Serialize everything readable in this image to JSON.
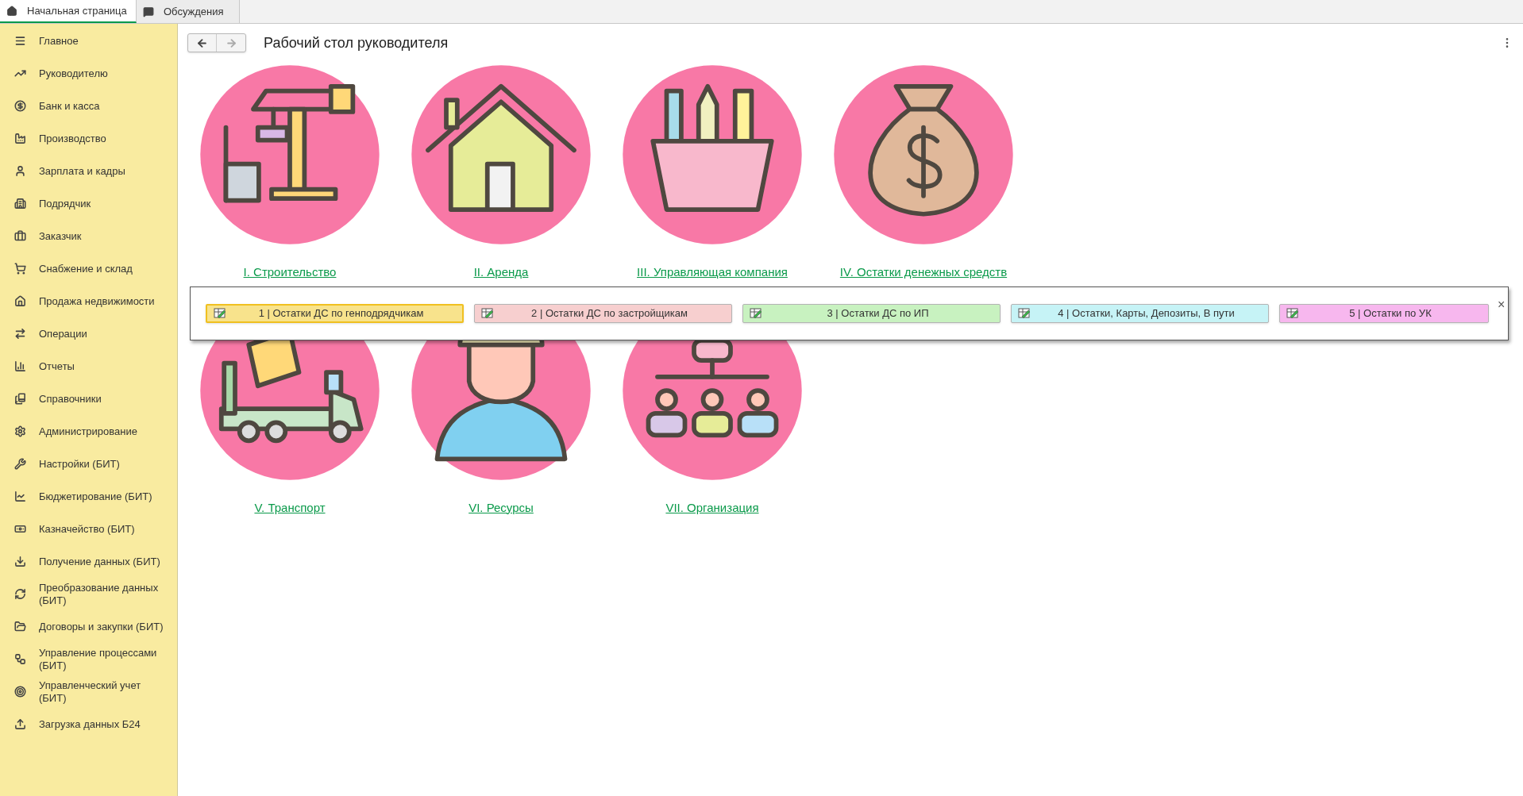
{
  "tabs": [
    {
      "label": "Начальная страница",
      "selected": true
    },
    {
      "label": "Обсуждения",
      "selected": false
    }
  ],
  "sidebar": {
    "items": [
      {
        "label": "Главное"
      },
      {
        "label": "Руководителю"
      },
      {
        "label": "Банк и касса"
      },
      {
        "label": "Производство"
      },
      {
        "label": "Зарплата и кадры"
      },
      {
        "label": "Подрядчик"
      },
      {
        "label": "Заказчик"
      },
      {
        "label": "Снабжение и склад"
      },
      {
        "label": "Продажа недвижимости"
      },
      {
        "label": "Операции"
      },
      {
        "label": "Отчеты"
      },
      {
        "label": "Справочники"
      },
      {
        "label": "Администрирование"
      },
      {
        "label": "Настройки (БИТ)"
      },
      {
        "label": "Бюджетирование (БИТ)"
      },
      {
        "label": "Казначейство (БИТ)"
      },
      {
        "label": "Получение данных (БИТ)"
      },
      {
        "label": "Преобразование данных (БИТ)"
      },
      {
        "label": "Договоры и закупки (БИТ)"
      },
      {
        "label": "Управление процессами (БИТ)"
      },
      {
        "label": "Управленческий учет (БИТ)"
      },
      {
        "label": "Загрузка данных Б24"
      }
    ]
  },
  "page": {
    "title": "Рабочий стол руководителя"
  },
  "tiles": [
    {
      "label": "I. Строительство"
    },
    {
      "label": "II. Аренда"
    },
    {
      "label": "III. Управляющая компания"
    },
    {
      "label": "IV. Остатки денежных средств"
    },
    {
      "label": "V. Транспорт"
    },
    {
      "label": "VI. Ресурсы"
    },
    {
      "label": "VII. Организация"
    }
  ],
  "popup": {
    "close": "×",
    "buttons": [
      {
        "label": "1 | Остатки ДС по генподрядчикам",
        "color": "#f8e38c",
        "selected": true
      },
      {
        "label": "2 | Остатки ДС по застройщикам",
        "color": "#f7cfcf",
        "selected": false
      },
      {
        "label": "3 | Остатки ДС по ИП",
        "color": "#c8f2c0",
        "selected": false
      },
      {
        "label": "4 | Остатки, Карты, Депозиты, В пути",
        "color": "#c6f3f6",
        "selected": false
      },
      {
        "label": "5 | Остатки по УК",
        "color": "#f7b7ee",
        "selected": false
      }
    ]
  }
}
